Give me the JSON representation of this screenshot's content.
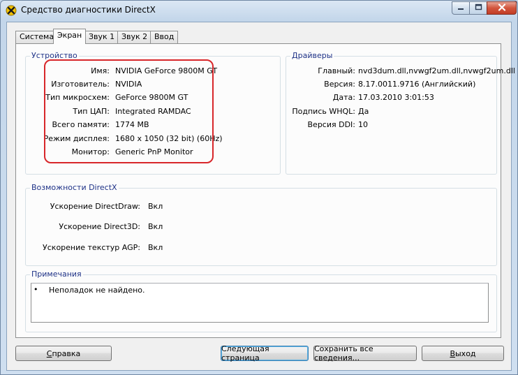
{
  "window": {
    "title": "Средство диагностики DirectX",
    "icon": "directx-icon"
  },
  "tabs": [
    {
      "label": "Система",
      "active": false
    },
    {
      "label": "Экран",
      "active": true
    },
    {
      "label": "Звук 1",
      "active": false
    },
    {
      "label": "Звук 2",
      "active": false
    },
    {
      "label": "Ввод",
      "active": false
    }
  ],
  "device": {
    "title": "Устройство",
    "rows": [
      {
        "label": "Имя:",
        "value": "NVIDIA GeForce 9800M GT"
      },
      {
        "label": "Изготовитель:",
        "value": "NVIDIA"
      },
      {
        "label": "Тип микросхем:",
        "value": "GeForce 9800M GT"
      },
      {
        "label": "Тип ЦАП:",
        "value": "Integrated RAMDAC"
      },
      {
        "label": "Всего памяти:",
        "value": "1774 MB"
      },
      {
        "label": "Режим дисплея:",
        "value": "1680 x 1050 (32 bit) (60Hz)"
      },
      {
        "label": "Монитор:",
        "value": "Generic PnP Monitor"
      }
    ]
  },
  "drivers": {
    "title": "Драйверы",
    "rows": [
      {
        "label": "Главный:",
        "value": "nvd3dum.dll,nvwgf2um.dll,nvwgf2um.dll"
      },
      {
        "label": "Версия:",
        "value": "8.17.0011.9716 (Английский)"
      },
      {
        "label": "Дата:",
        "value": "17.03.2010 3:01:53"
      },
      {
        "label": "Подпись WHQL:",
        "value": "Да"
      },
      {
        "label": "Версия DDI:",
        "value": "10"
      }
    ]
  },
  "features": {
    "title": "Возможности DirectX",
    "rows": [
      {
        "label": "Ускорение DirectDraw:",
        "value": "Вкл"
      },
      {
        "label": "Ускорение Direct3D:",
        "value": "Вкл"
      },
      {
        "label": "Ускорение текстур AGP:",
        "value": "Вкл"
      }
    ]
  },
  "notes": {
    "title": "Примечания",
    "bullet": "•",
    "items": [
      "Неполадок не найдено."
    ]
  },
  "buttons": {
    "help": {
      "mnemonic": "С",
      "rest": "правка"
    },
    "next": "Следующая страница",
    "save": "Сохранить все сведения...",
    "exit": {
      "mnemonic": "В",
      "rest": "ыход"
    }
  },
  "colors": {
    "group_title": "#1e3287",
    "highlight": "#d8262a",
    "close_button": "#c23d25"
  }
}
